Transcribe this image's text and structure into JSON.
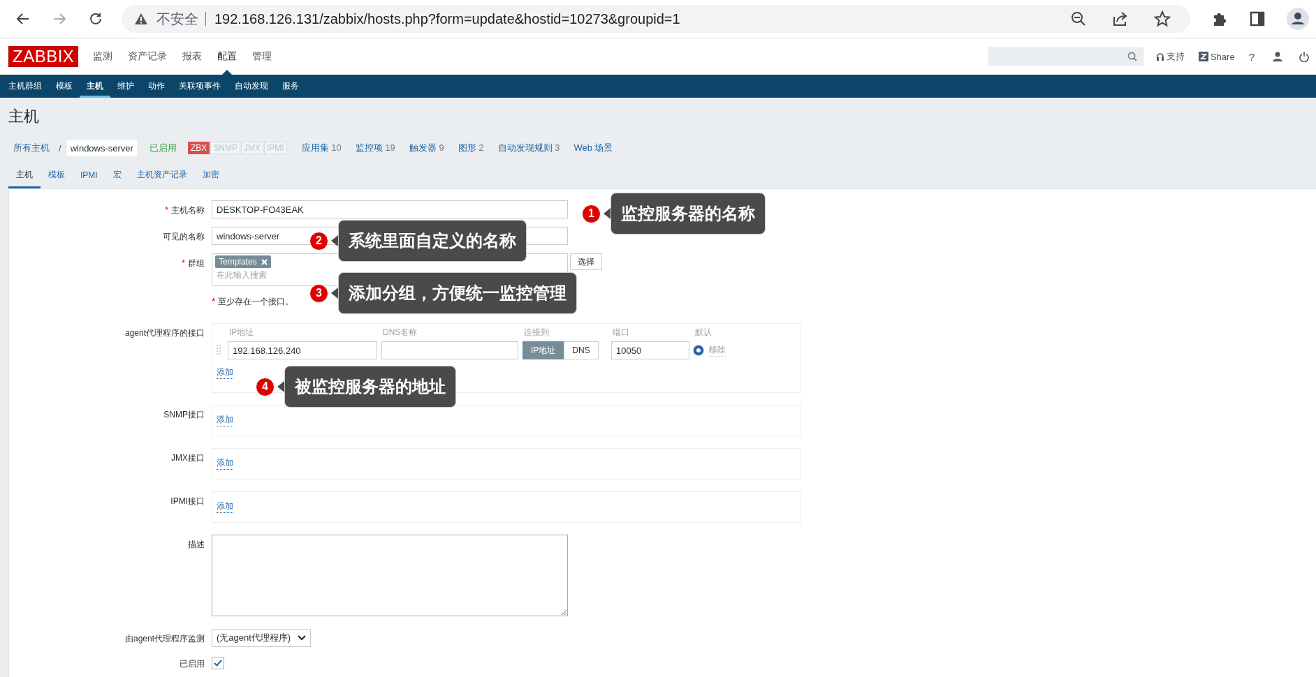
{
  "browser": {
    "security_label": "不安全",
    "url": "192.168.126.131/zabbix/hosts.php?form=update&hostid=10273&groupid=1"
  },
  "header": {
    "logo": "ZABBIX",
    "menu": [
      {
        "label": "监测",
        "selected": false
      },
      {
        "label": "资产记录",
        "selected": false
      },
      {
        "label": "报表",
        "selected": false
      },
      {
        "label": "配置",
        "selected": true
      },
      {
        "label": "管理",
        "selected": false
      }
    ],
    "support": "支持",
    "share": "Share",
    "help": "?"
  },
  "subnav": [
    {
      "label": "主机群组",
      "selected": false
    },
    {
      "label": "模板",
      "selected": false
    },
    {
      "label": "主机",
      "selected": true
    },
    {
      "label": "维护",
      "selected": false
    },
    {
      "label": "动作",
      "selected": false
    },
    {
      "label": "关联项事件",
      "selected": false
    },
    {
      "label": "自动发现",
      "selected": false
    },
    {
      "label": "服务",
      "selected": false
    }
  ],
  "page_title": "主机",
  "host_nav": {
    "breadcrumbs": [
      "所有主机",
      "windows-server"
    ],
    "separator": "/",
    "status": "已启用",
    "availability": [
      {
        "label": "ZBX",
        "on": true
      },
      {
        "label": "SNMP",
        "on": false
      },
      {
        "label": "JMX",
        "on": false
      },
      {
        "label": "IPMI",
        "on": false
      }
    ],
    "links": [
      {
        "label": "应用集",
        "count": "10"
      },
      {
        "label": "监控项",
        "count": "19"
      },
      {
        "label": "触发器",
        "count": "9"
      },
      {
        "label": "图形",
        "count": "2"
      },
      {
        "label": "自动发现规则",
        "count": "3"
      },
      {
        "label": "Web 场景"
      }
    ]
  },
  "tabs": [
    {
      "label": "主机",
      "selected": true
    },
    {
      "label": "模板",
      "selected": false
    },
    {
      "label": "IPMI",
      "selected": false
    },
    {
      "label": "宏",
      "selected": false
    },
    {
      "label": "主机资产记录",
      "selected": false
    },
    {
      "label": "加密",
      "selected": false
    }
  ],
  "form": [
    {
      "kind": "text",
      "required_mark": "*",
      "label": "主机名称",
      "value": "DESKTOP-FO43EAK"
    },
    {
      "kind": "text",
      "label": "可见的名称",
      "value": "windows-server"
    },
    {
      "kind": "multiselect",
      "required_mark": "*",
      "label": "群组",
      "tags": [
        "Templates"
      ],
      "placeholder": "在此输入搜索",
      "button": "选择"
    },
    {
      "kind": "note",
      "required_mark": "*",
      "text": "至少存在一个接口。"
    },
    {
      "kind": "interfaces",
      "label": "agent代理程序的接口",
      "columns": [
        "IP地址",
        "DNS名称",
        "连接到",
        "端口",
        "默认"
      ],
      "rows": [
        {
          "ip": "192.168.126.240",
          "connect": [
            {
              "label": "IP地址",
              "selected": true
            },
            {
              "label": "DNS",
              "selected": false
            }
          ],
          "port": "10050",
          "default": true,
          "remove": "移除",
          "remove_disabled": true
        }
      ],
      "add": "添加"
    },
    {
      "kind": "interfaces",
      "label": "SNMP接口",
      "add": "添加"
    },
    {
      "kind": "interfaces",
      "label": "JMX接口",
      "add": "添加"
    },
    {
      "kind": "interfaces",
      "label": "IPMI接口",
      "add": "添加"
    },
    {
      "kind": "textarea",
      "label": "描述"
    },
    {
      "kind": "select",
      "label": "由agent代理程序监测",
      "value": "(无agent代理程序)"
    },
    {
      "kind": "checkbox",
      "label": "已启用",
      "checked": true
    }
  ],
  "callouts": [
    {
      "number": "1",
      "text": "监控服务器的名称"
    },
    {
      "number": "2",
      "text": "系统里面自定义的名称"
    },
    {
      "number": "3",
      "text": "添加分组，方便统一监控管理"
    },
    {
      "number": "4",
      "text": "被监控服务器的地址"
    }
  ]
}
